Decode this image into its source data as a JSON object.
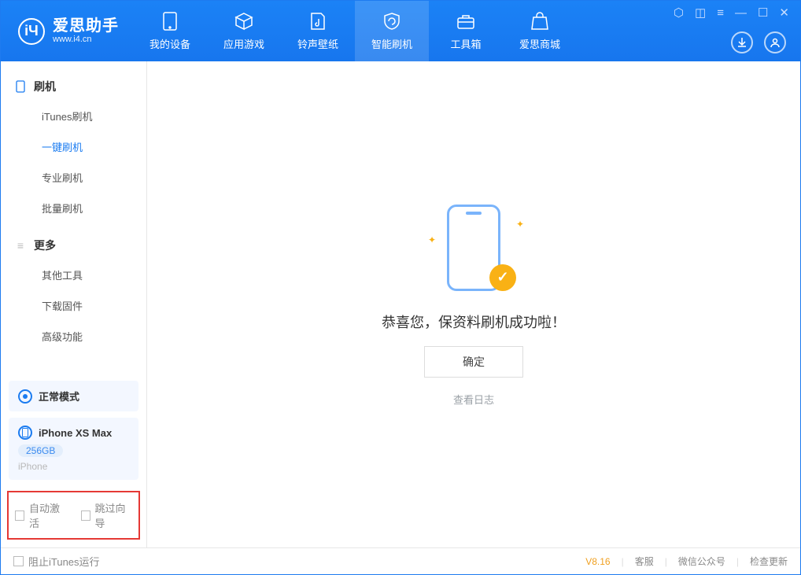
{
  "app": {
    "title": "爱思助手",
    "subtitle": "www.i4.cn"
  },
  "header": {
    "tabs": [
      {
        "label": "我的设备"
      },
      {
        "label": "应用游戏"
      },
      {
        "label": "铃声壁纸"
      },
      {
        "label": "智能刷机"
      },
      {
        "label": "工具箱"
      },
      {
        "label": "爱思商城"
      }
    ]
  },
  "sidebar": {
    "section1_title": "刷机",
    "section1_items": [
      "iTunes刷机",
      "一键刷机",
      "专业刷机",
      "批量刷机"
    ],
    "section2_title": "更多",
    "section2_items": [
      "其他工具",
      "下载固件",
      "高级功能"
    ],
    "mode_card": {
      "label": "正常模式"
    },
    "device_card": {
      "name": "iPhone XS Max",
      "storage": "256GB",
      "type": "iPhone"
    },
    "opts": {
      "auto_activate": "自动激活",
      "skip_guide": "跳过向导"
    }
  },
  "main": {
    "message": "恭喜您，保资料刷机成功啦！",
    "ok_label": "确定",
    "log_label": "查看日志"
  },
  "footer": {
    "block_label": "阻止iTunes运行",
    "version": "V8.16",
    "links": [
      "客服",
      "微信公众号",
      "检查更新"
    ]
  }
}
